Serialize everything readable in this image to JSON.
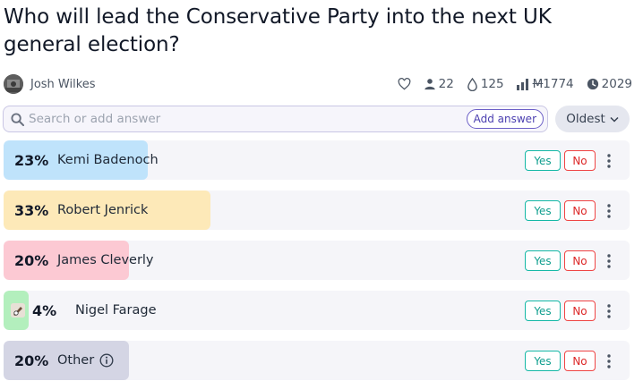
{
  "question": {
    "title": "Who will lead the Conservative Party into the next UK general election?"
  },
  "author": {
    "name": "Josh Wilkes",
    "avatar_icon": "user-photo"
  },
  "stats": {
    "like_icon": "heart-outline",
    "traders_icon": "person-icon",
    "traders": "22",
    "comments_icon": "droplet-icon",
    "comments": "125",
    "volume_icon": "bar-chart-icon",
    "volume": "1774",
    "volume_currency": "M",
    "close_icon": "clock-icon",
    "close_year": "2029"
  },
  "search": {
    "placeholder": "Search or add answer",
    "add_button_label": "Add answer"
  },
  "sort": {
    "label": "Oldest"
  },
  "answers": [
    {
      "percent_label": "23%",
      "probability": 0.23,
      "name": "Kemi Badenoch",
      "bar_color": "#bfe3fb",
      "yes_label": "Yes",
      "no_label": "No"
    },
    {
      "percent_label": "33%",
      "probability": 0.33,
      "name": "Robert Jenrick",
      "bar_color": "#fde9b8",
      "yes_label": "Yes",
      "no_label": "No"
    },
    {
      "percent_label": "20%",
      "probability": 0.2,
      "name": "James Cleverly",
      "bar_color": "#fcc9d3",
      "yes_label": "Yes",
      "no_label": "No"
    },
    {
      "percent_label": "4%",
      "probability": 0.04,
      "name": "Nigel Farage",
      "bar_color": "#b3efbd",
      "yes_label": "Yes",
      "no_label": "No"
    },
    {
      "percent_label": "20%",
      "probability": 0.2,
      "name": "Other",
      "bar_color": "#d4d5e4",
      "yes_label": "Yes",
      "no_label": "No"
    }
  ],
  "colors": {
    "yes": "#14b8a6",
    "no": "#ef4444",
    "accent": "#6c5fc7"
  }
}
